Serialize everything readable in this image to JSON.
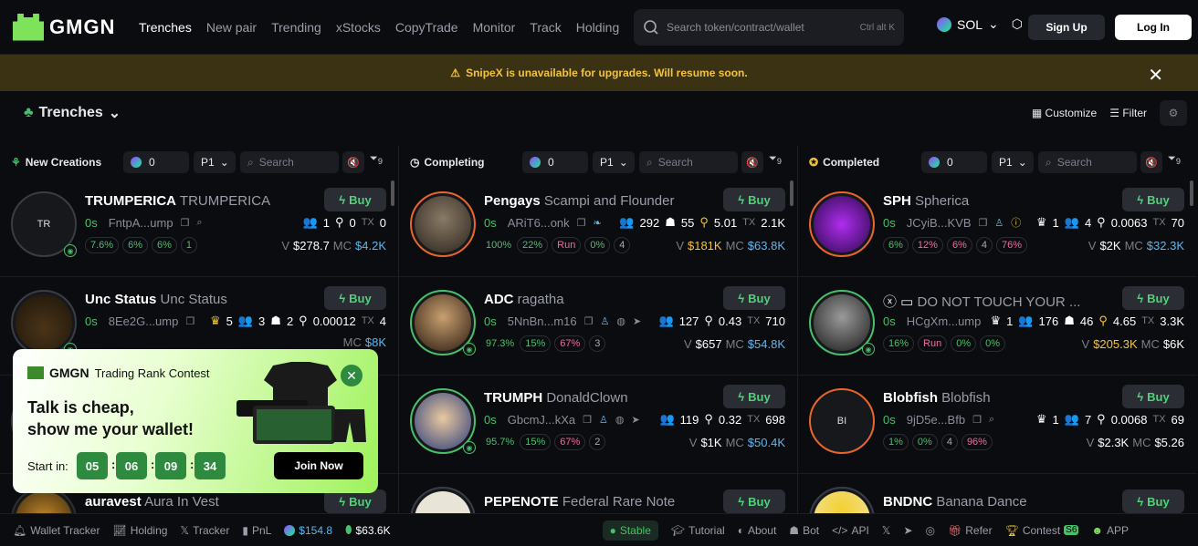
{
  "header": {
    "logo": "GMGN",
    "nav": [
      "Trenches",
      "New pair",
      "Trending",
      "xStocks",
      "CopyTrade",
      "Monitor",
      "Track",
      "Holding"
    ],
    "search_placeholder": "Search token/contract/wallet",
    "search_shortcut": "Ctrl alt K",
    "chain": "SOL",
    "signup": "Sign Up",
    "login": "Log In"
  },
  "banner": {
    "text": "SnipeX is unavailable for upgrades. Will resume soon."
  },
  "subhead": {
    "title": "Trenches",
    "customize": "Customize",
    "filter": "Filter"
  },
  "columns": [
    {
      "title": "New Creations",
      "sol": "0",
      "page": "P1",
      "search": "Search",
      "filter_count": "9"
    },
    {
      "title": "Completing",
      "sol": "0",
      "page": "P1",
      "search": "Search",
      "filter_count": "9"
    },
    {
      "title": "Completed",
      "sol": "0",
      "page": "P1",
      "search": "Search",
      "filter_count": "9"
    }
  ],
  "buy_label": "Buy",
  "cards": [
    [
      {
        "symbol": "TRUMPERICA",
        "name": "TRUMPERICA",
        "avatar_text": "TR",
        "avatar_style": "plain",
        "age": "0s",
        "addr": "FntpA...ump",
        "holders": "1",
        "snipers": "0",
        "tx": "0",
        "chips": [
          "7.6%",
          "6%",
          "6%",
          "1"
        ],
        "v": "$278.7",
        "mc": "$4.2K"
      },
      {
        "symbol": "Unc Status",
        "name": "Unc Status",
        "avatar_text": "UNC",
        "avatar_style": "plain",
        "age": "0s",
        "addr": "8Ee2G...ump",
        "holders": "5",
        "snipers": "3",
        "tx": "4",
        "chips": [
          "2",
          "0.00012"
        ],
        "v": "",
        "mc": "$8K"
      },
      {
        "symbol": "auravest",
        "name": "Aura In Vest",
        "avatar_text": "",
        "avatar_style": "plain",
        "age": "",
        "addr": "",
        "holders": "",
        "snipers": "",
        "tx": "",
        "chips": [],
        "v": "",
        "mc": ""
      }
    ],
    [
      {
        "symbol": "Pengays",
        "name": "Scampi and Flounder",
        "avatar_text": "",
        "avatar_style": "orange",
        "age": "0s",
        "addr": "ARiT6...onk",
        "holders": "292",
        "snipers": "55",
        "amt": "5.01",
        "tx": "2.1K",
        "chips": [
          "100%",
          "22%",
          "Run",
          "0%",
          "4"
        ],
        "v": "$181K",
        "mc": "$63.8K"
      },
      {
        "symbol": "ADC",
        "name": "ragatha",
        "avatar_text": "",
        "avatar_style": "green",
        "age": "0s",
        "addr": "5NnBn...m16",
        "holders": "127",
        "amt": "0.43",
        "tx": "710",
        "chips": [
          "97.3%",
          "15%",
          "67%",
          "3"
        ],
        "v": "$657",
        "mc": "$54.8K"
      },
      {
        "symbol": "TRUMPH",
        "name": "DonaldClown",
        "avatar_text": "",
        "avatar_style": "green",
        "age": "0s",
        "addr": "GbcmJ...kXa",
        "holders": "119",
        "amt": "0.32",
        "tx": "698",
        "chips": [
          "95.7%",
          "15%",
          "67%",
          "2"
        ],
        "v": "$1K",
        "mc": "$50.4K"
      },
      {
        "symbol": "PEPENOTE",
        "name": "Federal Rare Note",
        "avatar_text": "",
        "avatar_style": "plain"
      }
    ],
    [
      {
        "symbol": "SPH",
        "name": "Spherica",
        "avatar_text": "",
        "avatar_style": "orange",
        "age": "0s",
        "addr": "JCyiB...KVB",
        "holders": "1",
        "snipers": "4",
        "amt": "0.0063",
        "tx": "70",
        "chips": [
          "6%",
          "12%",
          "6%",
          "4",
          "76%"
        ],
        "v": "$2K",
        "mc": "$32.3K"
      },
      {
        "symbol": "",
        "name": "DO NOT TOUCH YOUR ...",
        "avatar_text": "",
        "avatar_style": "green",
        "age": "0s",
        "addr": "HCgXm...ump",
        "holders": "1",
        "snipers": "176",
        "amt": "4.65",
        "bots": "46",
        "tx": "3.3K",
        "chips": [
          "16%",
          "Run",
          "0%",
          "0%"
        ],
        "v": "$205.3K",
        "mc": "$6K"
      },
      {
        "symbol": "Blobfish",
        "name": "Blobfish",
        "avatar_text": "BI",
        "avatar_style": "orange",
        "age": "0s",
        "addr": "9jD5e...Bfb",
        "holders": "1",
        "snipers": "7",
        "amt": "0.0068",
        "tx": "69",
        "chips": [
          "1%",
          "0%",
          "4",
          "96%"
        ],
        "v": "$2.3K",
        "mc": "$5.26"
      },
      {
        "symbol": "BNDNC",
        "name": "Banana Dance",
        "avatar_text": "",
        "avatar_style": "plain"
      }
    ]
  ],
  "promo": {
    "brand": "GMGN",
    "title": "Trading Rank Contest",
    "slogan_1": "Talk is cheap,",
    "slogan_2": "show me your wallet!",
    "start_label": "Start in:",
    "t": [
      "05",
      "06",
      "09",
      "34"
    ],
    "join": "Join Now"
  },
  "footer": {
    "wallet_tracker": "Wallet Tracker",
    "holding": "Holding",
    "tracker": "Tracker",
    "pnl": "PnL",
    "sol_price": "$154.8",
    "other_price": "$63.6K",
    "stable": "Stable",
    "tutorial": "Tutorial",
    "about": "About",
    "bot": "Bot",
    "api": "API",
    "refer": "Refer",
    "contest": "Contest",
    "contest_badge": "S6",
    "app": "APP"
  },
  "colors": {
    "accent_green": "#48c06a",
    "warning": "#f4c33a",
    "mc_blue": "#5ab7f0",
    "bg": "#0b0c0f"
  }
}
